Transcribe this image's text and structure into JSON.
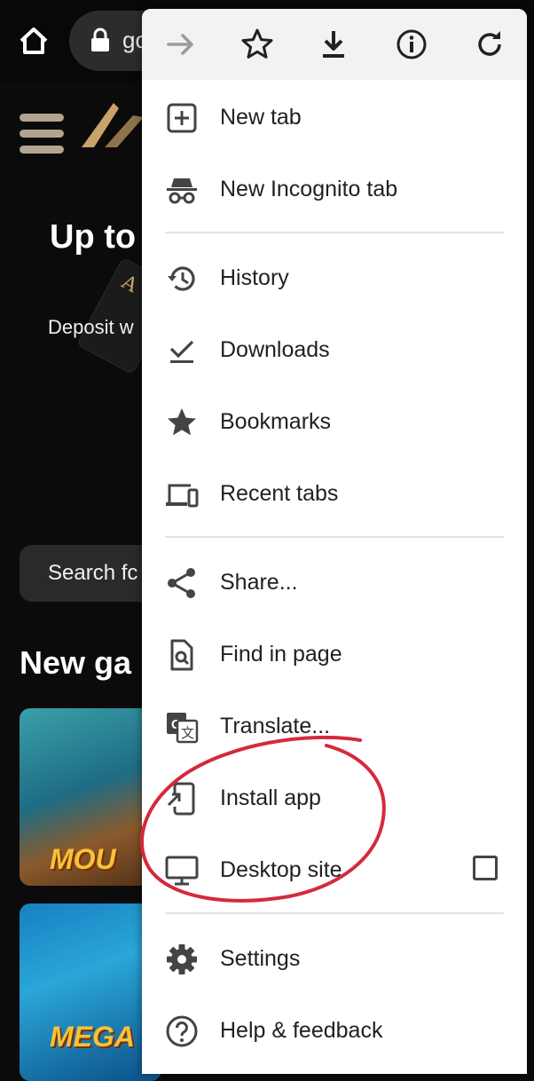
{
  "browser": {
    "url_fragment": "gc",
    "toolbar": {
      "forward": "forward-icon",
      "bookmark": "star-icon",
      "download": "download-icon",
      "info": "info-icon",
      "refresh": "refresh-icon"
    }
  },
  "page": {
    "hero_title": "Up to",
    "hero_subtitle": "Deposit w",
    "card_letter": "A",
    "search_placeholder": "Search fc",
    "section_title": "New ga",
    "tiles": [
      "MOU",
      "MEGA"
    ]
  },
  "menu": {
    "new_tab": "New tab",
    "new_incognito": "New Incognito tab",
    "history": "History",
    "downloads": "Downloads",
    "bookmarks": "Bookmarks",
    "recent_tabs": "Recent tabs",
    "share": "Share...",
    "find_in_page": "Find in page",
    "translate": "Translate...",
    "install_app": "Install app",
    "desktop_site": "Desktop site",
    "desktop_site_checked": false,
    "settings": "Settings",
    "help": "Help & feedback"
  },
  "colors": {
    "annotation": "#d42a3c",
    "menu_bg": "#ffffff",
    "toolbar_bg": "#f2f2f2",
    "text": "#202124"
  }
}
